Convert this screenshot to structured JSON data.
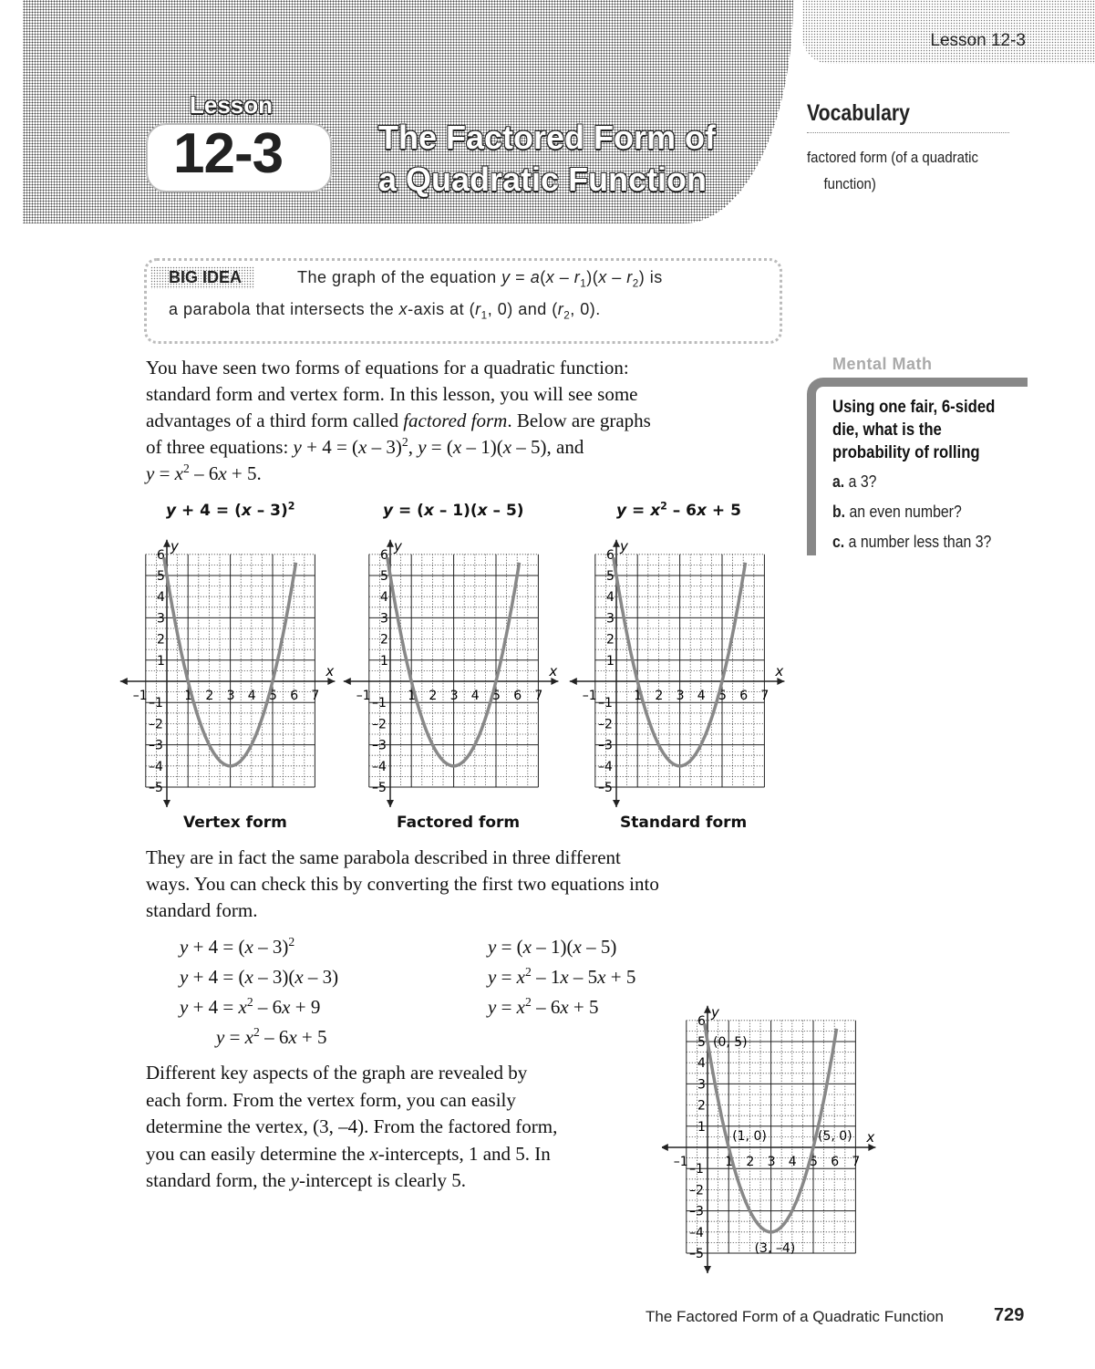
{
  "header": {
    "tab_label": "Lesson 12-3",
    "lesson_word": "Lesson",
    "lesson_number": "12-3",
    "title_lines": [
      "The Factored Form of",
      "a Quadratic Function"
    ]
  },
  "vocabulary": {
    "title": "Vocabulary",
    "term_line1": "factored form (of a quadratic",
    "term_line2": "function)"
  },
  "big_idea": {
    "label": "BIG IDEA",
    "lines": [
      [
        {
          "t": "The graph of the equation "
        },
        {
          "t": "y",
          "s": "i"
        },
        {
          "t": " = "
        },
        {
          "t": "a",
          "s": "i"
        },
        {
          "t": "("
        },
        {
          "t": "x",
          "s": "i"
        },
        {
          "t": " – "
        },
        {
          "t": "r",
          "s": "i"
        },
        {
          "t": "1",
          "s": "sub"
        },
        {
          "t": ")("
        },
        {
          "t": "x",
          "s": "i"
        },
        {
          "t": " – "
        },
        {
          "t": "r",
          "s": "i"
        },
        {
          "t": "2",
          "s": "sub"
        },
        {
          "t": ") is"
        }
      ],
      [
        {
          "t": "a parabola that intersects the "
        },
        {
          "t": "x",
          "s": "i"
        },
        {
          "t": "-axis at ("
        },
        {
          "t": "r",
          "s": "i"
        },
        {
          "t": "1",
          "s": "sub"
        },
        {
          "t": ", 0) and ("
        },
        {
          "t": "r",
          "s": "i"
        },
        {
          "t": "2",
          "s": "sub"
        },
        {
          "t": ", 0)."
        }
      ]
    ]
  },
  "paragraph1": [
    [
      {
        "t": "You have seen two forms of equations for a quadratic function:"
      }
    ],
    [
      {
        "t": "standard form and vertex form. In this lesson, you will see some"
      }
    ],
    [
      {
        "t": "advantages of a third form called "
      },
      {
        "t": "factored form",
        "s": "i"
      },
      {
        "t": ". Below are graphs"
      }
    ],
    [
      {
        "t": "of three equations: "
      },
      {
        "t": "y",
        "s": "i"
      },
      {
        "t": " + 4 = ("
      },
      {
        "t": "x",
        "s": "i"
      },
      {
        "t": " – 3)"
      },
      {
        "t": "2",
        "s": "sup"
      },
      {
        "t": ", "
      },
      {
        "t": "y",
        "s": "i"
      },
      {
        "t": " = ("
      },
      {
        "t": "x",
        "s": "i"
      },
      {
        "t": " – 1)("
      },
      {
        "t": "x",
        "s": "i"
      },
      {
        "t": " – 5), and"
      }
    ],
    [
      {
        "t": "y",
        "s": "i"
      },
      {
        "t": " = "
      },
      {
        "t": "x",
        "s": "i"
      },
      {
        "t": "2",
        "s": "sup"
      },
      {
        "t": " – 6"
      },
      {
        "t": "x",
        "s": "i"
      },
      {
        "t": " + 5."
      }
    ]
  ],
  "graphs": [
    {
      "title": [
        {
          "t": "y",
          "s": "i"
        },
        {
          "t": " + 4 = ("
        },
        {
          "t": "x",
          "s": "i"
        },
        {
          "t": " – 3)"
        },
        {
          "t": "2",
          "s": "sup"
        }
      ],
      "caption": "Vertex form",
      "equation": "y + 4 = (x - 3)^2"
    },
    {
      "title": [
        {
          "t": "y",
          "s": "i"
        },
        {
          "t": " = ("
        },
        {
          "t": "x",
          "s": "i"
        },
        {
          "t": " – 1)("
        },
        {
          "t": "x",
          "s": "i"
        },
        {
          "t": " – 5)"
        }
      ],
      "caption": "Factored form",
      "equation": "y = (x - 1)(x - 5)"
    },
    {
      "title": [
        {
          "t": "y",
          "s": "i"
        },
        {
          "t": " = "
        },
        {
          "t": "x",
          "s": "i"
        },
        {
          "t": "2",
          "s": "sup"
        },
        {
          "t": " – 6"
        },
        {
          "t": "x",
          "s": "i"
        },
        {
          "t": " + 5"
        }
      ],
      "caption": "Standard form",
      "equation": "y = x^2 - 6x + 5"
    }
  ],
  "chart_data": {
    "type": "line",
    "function": "y = x^2 - 6x + 5",
    "xlabel": "x",
    "ylabel": "y",
    "xlim": [
      -1,
      7
    ],
    "ylim": [
      -5,
      6
    ],
    "x_ticks": [
      "-1",
      "1",
      "2",
      "3",
      "4",
      "5",
      "6",
      "7"
    ],
    "y_ticks": [
      "6",
      "5",
      "4",
      "3",
      "2",
      "1",
      "-1",
      "-2",
      "-3",
      "-4",
      "-5"
    ],
    "grid": true,
    "annotated_points": [
      {
        "label": "(0, 5)",
        "x": 0,
        "y": 5
      },
      {
        "label": "(1, 0)",
        "x": 1,
        "y": 0
      },
      {
        "label": "(5, 0)",
        "x": 5,
        "y": 0
      },
      {
        "label": "(3, –4)",
        "x": 3,
        "y": -4
      }
    ]
  },
  "paragraph2": [
    [
      {
        "t": "They are in fact the same parabola described in three different"
      }
    ],
    [
      {
        "t": "ways. You can check this by converting the first two equations into"
      }
    ],
    [
      {
        "t": "standard form."
      }
    ]
  ],
  "equations_left": [
    [
      {
        "t": "y",
        "s": "i"
      },
      {
        "t": " + 4 = ("
      },
      {
        "t": "x",
        "s": "i"
      },
      {
        "t": " – 3)"
      },
      {
        "t": "2",
        "s": "sup"
      }
    ],
    [
      {
        "t": "y",
        "s": "i"
      },
      {
        "t": " + 4 = ("
      },
      {
        "t": "x",
        "s": "i"
      },
      {
        "t": " – 3)("
      },
      {
        "t": "x",
        "s": "i"
      },
      {
        "t": " – 3)"
      }
    ],
    [
      {
        "t": "y",
        "s": "i"
      },
      {
        "t": " + 4 = "
      },
      {
        "t": "x",
        "s": "i"
      },
      {
        "t": "2",
        "s": "sup"
      },
      {
        "t": " – 6"
      },
      {
        "t": "x",
        "s": "i"
      },
      {
        "t": " + 9"
      }
    ],
    [
      {
        "t": "y",
        "s": "i"
      },
      {
        "t": " = "
      },
      {
        "t": "x",
        "s": "i"
      },
      {
        "t": "2",
        "s": "sup"
      },
      {
        "t": " – 6"
      },
      {
        "t": "x",
        "s": "i"
      },
      {
        "t": " + 5"
      }
    ]
  ],
  "equations_right": [
    [
      {
        "t": "y",
        "s": "i"
      },
      {
        "t": " = ("
      },
      {
        "t": "x",
        "s": "i"
      },
      {
        "t": " – 1)("
      },
      {
        "t": "x",
        "s": "i"
      },
      {
        "t": " – 5)"
      }
    ],
    [
      {
        "t": "y",
        "s": "i"
      },
      {
        "t": " = "
      },
      {
        "t": "x",
        "s": "i"
      },
      {
        "t": "2",
        "s": "sup"
      },
      {
        "t": " – 1"
      },
      {
        "t": "x",
        "s": "i"
      },
      {
        "t": " – 5"
      },
      {
        "t": "x",
        "s": "i"
      },
      {
        "t": " + 5"
      }
    ],
    [
      {
        "t": "y",
        "s": "i"
      },
      {
        "t": " = "
      },
      {
        "t": "x",
        "s": "i"
      },
      {
        "t": "2",
        "s": "sup"
      },
      {
        "t": " – 6"
      },
      {
        "t": "x",
        "s": "i"
      },
      {
        "t": " + 5"
      }
    ]
  ],
  "paragraph3": [
    [
      {
        "t": "Different key aspects of the graph are revealed by"
      }
    ],
    [
      {
        "t": "each form. From the vertex form, you can easily"
      }
    ],
    [
      {
        "t": "determine the vertex, (3, –4). From the factored form,"
      }
    ],
    [
      {
        "t": "you can easily determine the "
      },
      {
        "t": "x",
        "s": "i"
      },
      {
        "t": "-intercepts, 1 and 5. In"
      }
    ],
    [
      {
        "t": "standard form, the "
      },
      {
        "t": "y",
        "s": "i"
      },
      {
        "t": "-intercept is clearly 5."
      }
    ]
  ],
  "mental_math": {
    "title": "Mental Math",
    "question": "Using one fair, 6-sided die, what is the probability of rolling",
    "options": [
      {
        "letter": "a.",
        "text": " a 3?"
      },
      {
        "letter": "b.",
        "text": " an even number?"
      },
      {
        "letter": "c.",
        "text": " a number less than 3?"
      }
    ]
  },
  "footer": {
    "title": "The Factored Form of a Quadratic Function",
    "page_number": "729"
  },
  "colors": {
    "curve": "#888888",
    "grid": "#222222",
    "text": "#111111"
  }
}
